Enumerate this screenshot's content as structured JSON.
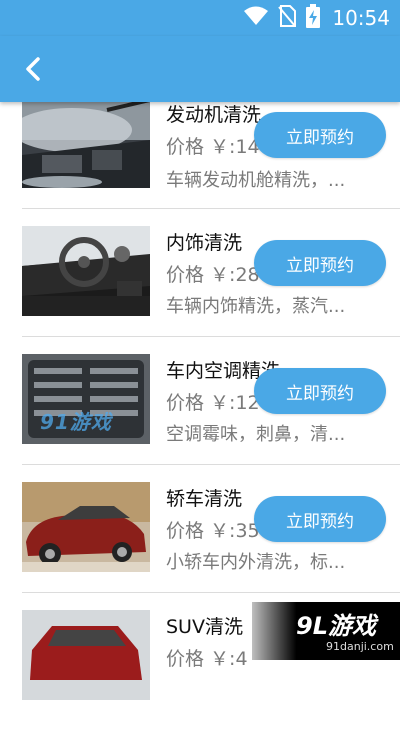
{
  "status_bar": {
    "time": "10:54"
  },
  "app_bar": {
    "back_icon": "chevron-left-icon"
  },
  "services": [
    {
      "title": "发动机清洗",
      "price_label": "价格 ￥:",
      "price_value": "14",
      "description": "车辆发动机舱精洗，...",
      "button": "立即预约",
      "thumb": "engine-wash"
    },
    {
      "title": "内饰清洗",
      "price_label": "价格 ￥:",
      "price_value": "28",
      "description": "车辆内饰精洗，蒸汽...",
      "button": "立即预约",
      "thumb": "interior"
    },
    {
      "title": "车内空调精洗",
      "price_label": "价格 ￥:",
      "price_value": "12",
      "description": "空调霉味，刺鼻，清...",
      "button": "立即预约",
      "thumb": "ac-vent"
    },
    {
      "title": "轿车清洗",
      "price_label": "价格 ￥:",
      "price_value": "35",
      "description": "小轿车内外清洗，标...",
      "button": "立即预约",
      "thumb": "sedan"
    },
    {
      "title": "SUV清洗",
      "price_label": "价格 ￥:",
      "price_value": "4",
      "description": "",
      "button": "",
      "thumb": "suv"
    }
  ],
  "watermark": {
    "main": "9L游戏",
    "sub": "91danji.com",
    "thumb_mark": "91游戏"
  },
  "colors": {
    "primary": "#4aa8e6",
    "text_dark": "#111111",
    "text_gray": "#7a7a7a"
  }
}
